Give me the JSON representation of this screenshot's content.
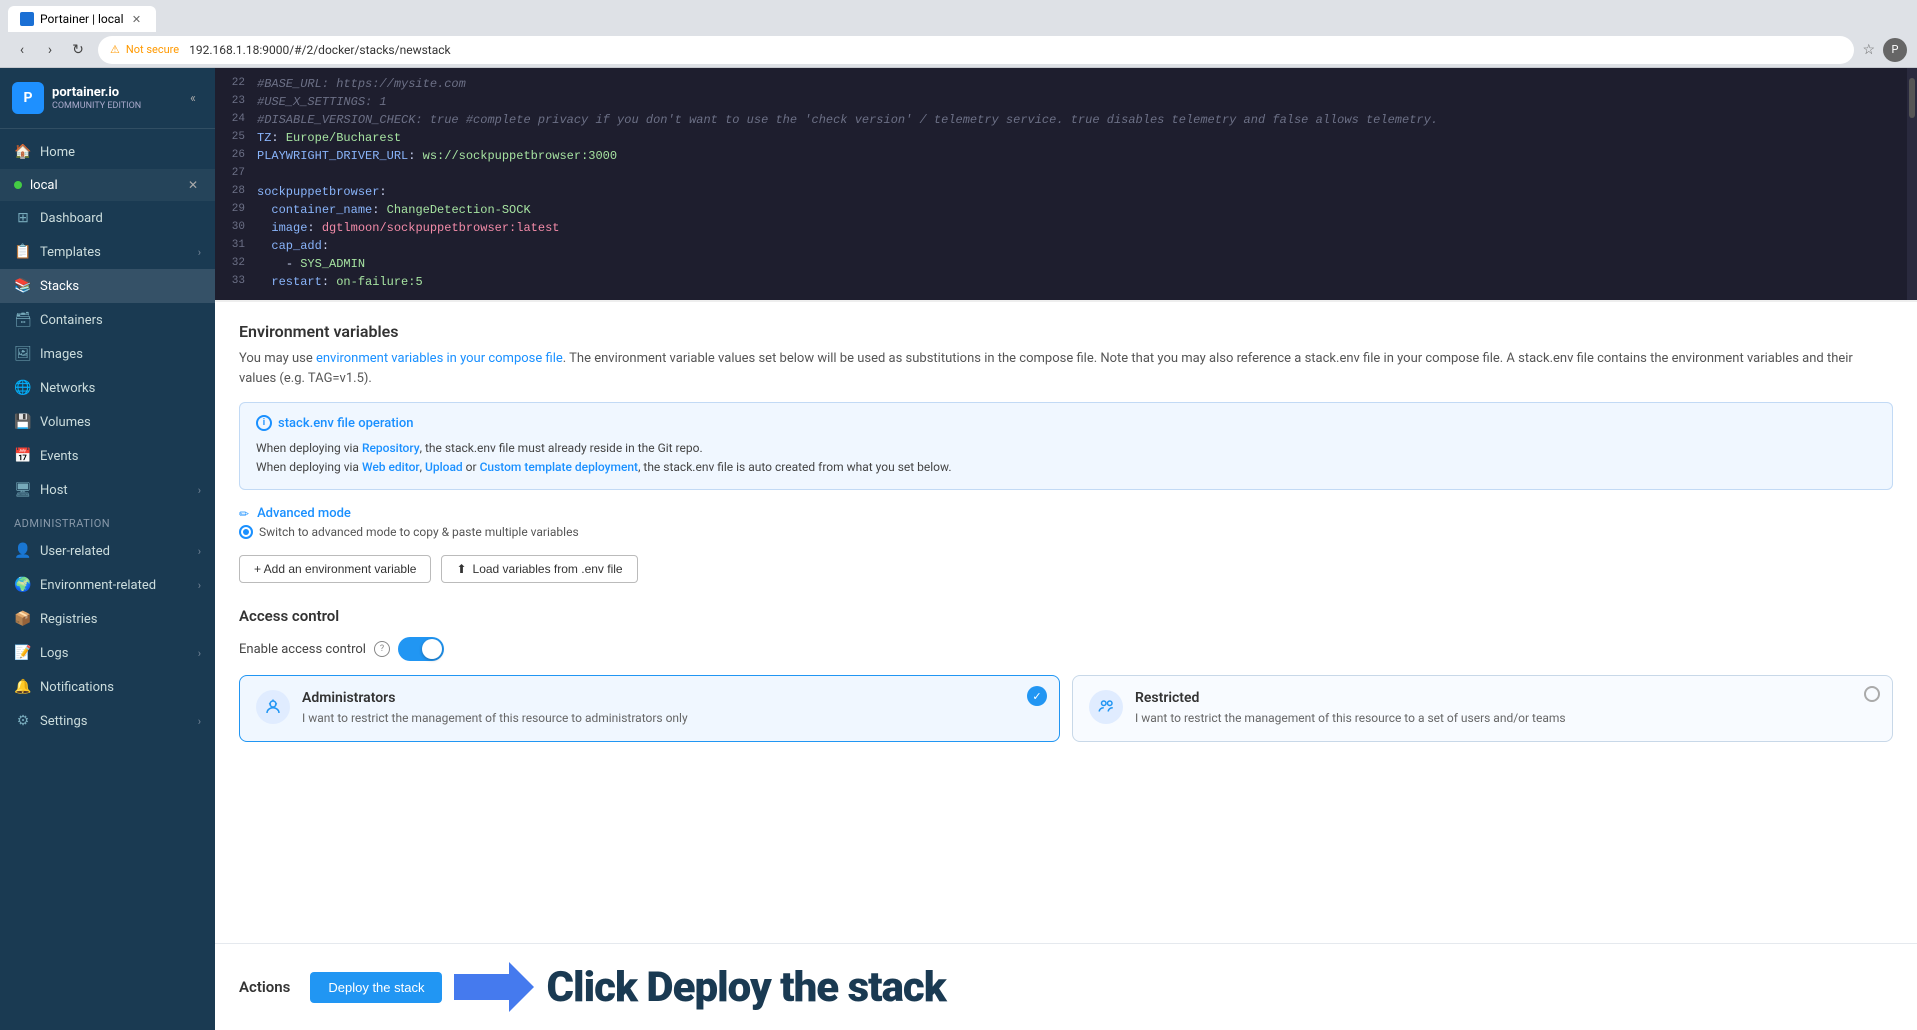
{
  "browser": {
    "tab_title": "Portainer | local",
    "url": "192.168.1.18:9000/#/2/docker/stacks/newstack",
    "security_label": "Not secure",
    "profile_initial": "P"
  },
  "sidebar": {
    "logo_text": "portainer.io",
    "logo_sub": "COMMUNITY EDITION",
    "endpoint": "local",
    "nav_items": [
      {
        "id": "home",
        "label": "Home",
        "icon": "🏠"
      },
      {
        "id": "dashboard",
        "label": "Dashboard",
        "icon": "⊞"
      },
      {
        "id": "templates",
        "label": "Templates",
        "icon": "📋",
        "has_chevron": true
      },
      {
        "id": "stacks",
        "label": "Stacks",
        "icon": "📚",
        "active": true
      },
      {
        "id": "containers",
        "label": "Containers",
        "icon": "🗃"
      },
      {
        "id": "images",
        "label": "Images",
        "icon": "🖼"
      },
      {
        "id": "networks",
        "label": "Networks",
        "icon": "🌐"
      },
      {
        "id": "volumes",
        "label": "Volumes",
        "icon": "💾"
      },
      {
        "id": "events",
        "label": "Events",
        "icon": "📅"
      },
      {
        "id": "host",
        "label": "Host",
        "icon": "🖥",
        "has_chevron": true
      }
    ],
    "admin_section": "Administration",
    "admin_items": [
      {
        "id": "user-related",
        "label": "User-related",
        "icon": "👤",
        "has_chevron": true
      },
      {
        "id": "environment-related",
        "label": "Environment-related",
        "icon": "🌍",
        "has_chevron": true
      },
      {
        "id": "registries",
        "label": "Registries",
        "icon": "📦"
      },
      {
        "id": "logs",
        "label": "Logs",
        "icon": "📝",
        "has_chevron": true
      },
      {
        "id": "notifications",
        "label": "Notifications",
        "icon": "🔔"
      },
      {
        "id": "settings",
        "label": "Settings",
        "icon": "⚙",
        "has_chevron": true
      }
    ]
  },
  "code_editor": {
    "lines": [
      {
        "num": 22,
        "content": "#BASE_URL: https://mysite.com",
        "type": "comment"
      },
      {
        "num": 23,
        "content": "#USE_X_SETTINGS: 1",
        "type": "comment"
      },
      {
        "num": 24,
        "content": "#DISABLE_VERSION_CHECK: true #complete privacy if you don't want to use the 'check version' / telemetry service. true disables telemetry and false allows telemetry.",
        "type": "comment"
      },
      {
        "num": 25,
        "content": "TZ: Europe/Bucharest",
        "type": "keyval"
      },
      {
        "num": 26,
        "content": "PLAYWRIGHT_DRIVER_URL: ws://sockpuppetbrowser:3000",
        "type": "keyval"
      },
      {
        "num": 27,
        "content": "",
        "type": "empty"
      },
      {
        "num": 28,
        "content": "sockpuppetbrowser:",
        "type": "service"
      },
      {
        "num": 29,
        "content": "  container_name: ChangeDetection-SOCK",
        "type": "keyval_indent"
      },
      {
        "num": 30,
        "content": "  image: dgtlmoon/sockpuppetbrowser:latest",
        "type": "keyval_indent"
      },
      {
        "num": 31,
        "content": "  cap_add:",
        "type": "keyval_indent"
      },
      {
        "num": 32,
        "content": "    - SYS_ADMIN",
        "type": "list_indent"
      },
      {
        "num": 33,
        "content": "  restart: on-failure:5",
        "type": "keyval_indent"
      }
    ]
  },
  "env_section": {
    "title": "Environment variables",
    "desc_text": "You may use ",
    "desc_link": "environment variables in your compose file",
    "desc_after": ". The environment variable values set below will be used as substitutions in the compose file. Note that you may also reference a stack.env file in your compose file. A stack.env file contains the environment variables and their values (e.g. TAG=v1.5).",
    "info_title": "stack.env file operation",
    "info_line1_pre": "When deploying via ",
    "info_line1_link": "Repository",
    "info_line1_after": ", the stack.env file must already reside in the Git repo.",
    "info_line2_pre": "When deploying via ",
    "info_line2_link1": "Web editor",
    "info_line2_sep": ", ",
    "info_line2_link2": "Upload",
    "info_line2_sep2": " or ",
    "info_line2_link3": "Custom template deployment",
    "info_line2_after": ", the stack.env file is auto created from what you set below.",
    "advanced_mode_label": "Advanced mode",
    "switch_desc": "Switch to advanced mode to copy & paste multiple variables",
    "btn_add": "+ Add an environment variable",
    "btn_load": "Load variables from .env file"
  },
  "access_section": {
    "title": "Access control",
    "enable_label": "Enable access control",
    "toggle_on": true,
    "admins_option": {
      "title": "Administrators",
      "desc": "I want to restrict the management of this resource to administrators only",
      "selected": true
    },
    "restricted_option": {
      "title": "Restricted",
      "desc": "I want to restrict the management of this resource to a set of users and/or teams",
      "selected": false
    }
  },
  "actions": {
    "title": "Actions",
    "deploy_btn": "Deploy the stack",
    "annotation_text": "Click Deploy the stack"
  }
}
